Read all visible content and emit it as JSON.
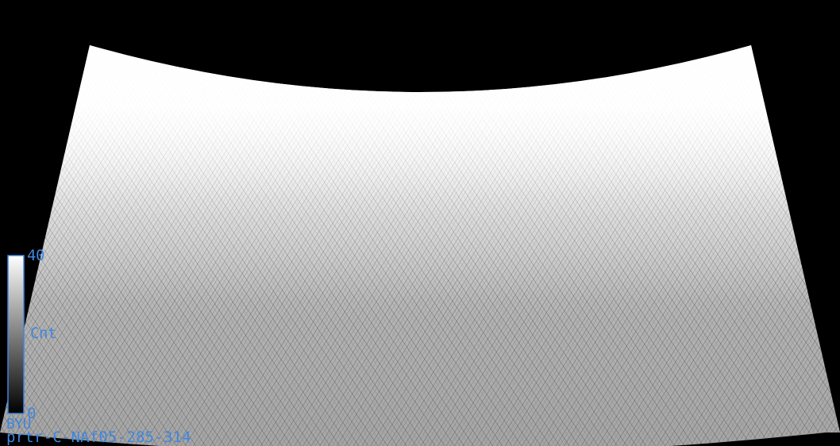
{
  "map": {
    "projection": "polar-fan swath",
    "background_color": "#000000",
    "colormap": "grayscale (low = black, high = white)"
  },
  "colorbar": {
    "max_label": "40",
    "min_label": "0",
    "units_label": "Cnt",
    "max_value": 40,
    "min_value": 0,
    "label_color": "#3f86df",
    "border_color": "#3f86df"
  },
  "footer": {
    "source_label": "BYU",
    "title": "prtr-C-NAf05-285-314"
  }
}
